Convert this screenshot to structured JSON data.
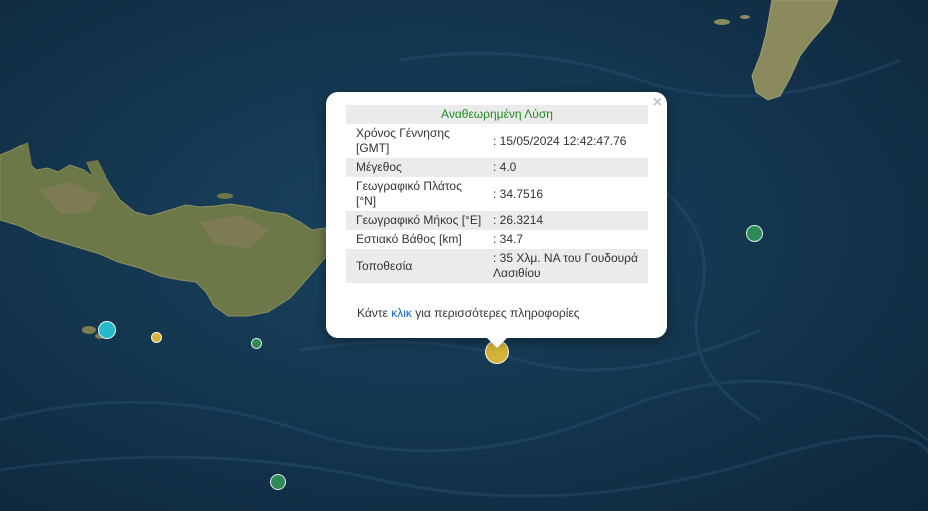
{
  "popup": {
    "title": "Αναθεωρημένη Λύση",
    "close_symbol": "×",
    "rows": [
      {
        "label": "Χρόνος Γέννησης [GMT]",
        "value": ": 15/05/2024 12:42:47.76"
      },
      {
        "label": "Μέγεθος",
        "value": ": 4.0"
      },
      {
        "label": "Γεωγραφικό Πλάτος [°N]",
        "value": ": 34.7516"
      },
      {
        "label": "Γεωγραφικό Μήκος [°E]",
        "value": ": 26.3214"
      },
      {
        "label": "Εστιακό Βάθος [km]",
        "value": ": 34.7"
      },
      {
        "label": "Τοποθεσία",
        "value": ": 35 Χλμ. ΝΑ του Γουδουρά Λασιθίου"
      }
    ],
    "more_prefix": "Κάντε ",
    "more_link": "κλικ",
    "more_suffix": " για περισσότερες πληροφορίες"
  },
  "colors": {
    "sea": "#143650",
    "land": "#6f7a4a",
    "marker_yellow": "#d4b43a",
    "marker_green": "#2e8b57",
    "marker_cyan": "#27b8cc",
    "title_green": "#1e8a1e",
    "link_blue": "#1565c0"
  }
}
